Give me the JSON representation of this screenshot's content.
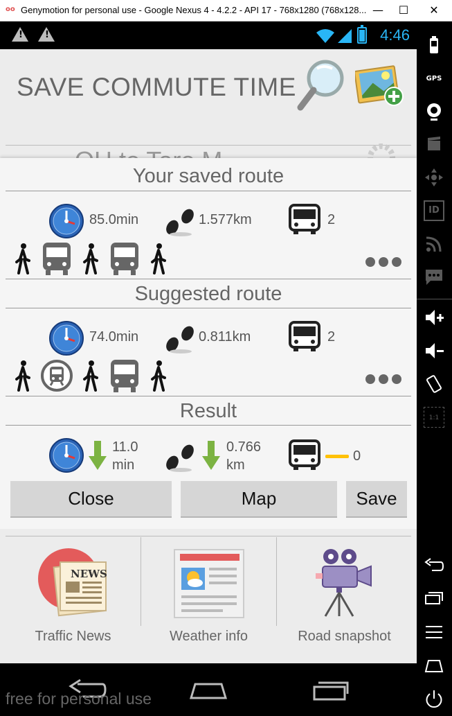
{
  "window": {
    "title": "Genymotion for personal use - Google Nexus 4 - 4.2.2 - API 17 - 768x1280 (768x128...",
    "logo": "oo",
    "minimize": "—",
    "maximize": "☐",
    "close": "✕"
  },
  "status_bar": {
    "time": "4:46",
    "warning_icons": [
      "warning-icon",
      "warning-icon"
    ],
    "accent": "#29b6f6"
  },
  "app": {
    "title": "SAVE COMMUTE TIME",
    "behind_text": "OH to Taro M",
    "search_icon": "magnifier-icon",
    "add_icon": "add-picture-icon"
  },
  "dialog": {
    "saved": {
      "title": "Your saved route",
      "time": "85.0min",
      "distance": "1.577km",
      "bus_count": "2",
      "legs": [
        "walk",
        "bus",
        "walk",
        "bus",
        "walk"
      ]
    },
    "suggested": {
      "title": "Suggested route",
      "time": "74.0min",
      "distance": "0.811km",
      "bus_count": "2",
      "legs": [
        "walk",
        "train",
        "walk",
        "bus",
        "walk"
      ]
    },
    "result": {
      "title": "Result",
      "time_value": "11.0",
      "time_unit": "min",
      "distance_value": "0.766",
      "distance_unit": "km",
      "bus_count": "0"
    },
    "buttons": {
      "close": "Close",
      "map": "Map",
      "save": "Save"
    }
  },
  "bottom": {
    "traffic_news": "Traffic News",
    "news_badge": "NEWS",
    "weather_info": "Weather info",
    "road_snapshot": "Road snapshot"
  },
  "watermark": "free for personal use",
  "sidebar": {
    "gps_label": "GPS",
    "id_label": "ID",
    "scale_label": "1:1"
  }
}
